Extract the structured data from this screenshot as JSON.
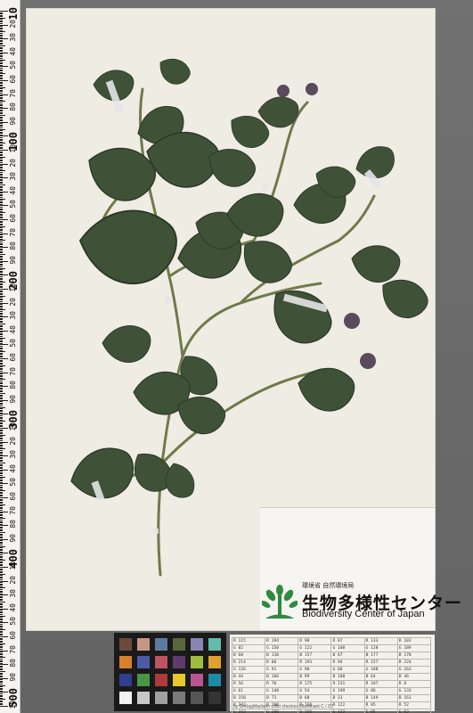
{
  "ruler": {
    "major_labels": [
      "10",
      "100",
      "200",
      "300",
      "400",
      "500"
    ],
    "minor_labels": [
      "20",
      "30",
      "40",
      "50",
      "60",
      "70",
      "80",
      "90",
      "10",
      "20",
      "30",
      "40",
      "50",
      "60",
      "70",
      "80",
      "90",
      "10",
      "20",
      "30",
      "40",
      "50",
      "60",
      "70",
      "80",
      "90",
      "10",
      "20",
      "30",
      "40",
      "50",
      "60",
      "70",
      "80",
      "90",
      "10",
      "20",
      "30",
      "40",
      "50",
      "60",
      "70",
      "80",
      "90",
      "10"
    ]
  },
  "label": {
    "org_small_jp": "環境省 自然環境局",
    "org_name_jp": "生物多様性センター",
    "org_name_en": "Biodiversity Center of Japan",
    "logo_icon": "plant-sprout-logo-icon",
    "logo_color": "#2f8a3e"
  },
  "color_checker": {
    "swatches": [
      "#6b4a3c",
      "#c59782",
      "#5f7aa0",
      "#59683c",
      "#8787b1",
      "#62bca9",
      "#d9802d",
      "#4d5ba6",
      "#bc5462",
      "#5e3b6b",
      "#9fbc3f",
      "#e0a12e",
      "#2f3e8e",
      "#4a9446",
      "#af3a3a",
      "#e9c72b",
      "#b8548f",
      "#1f89a3",
      "#f2f2f2",
      "#c8c8c8",
      "#a0a0a0",
      "#7a7a7a",
      "#555555",
      "#343434"
    ]
  },
  "reference_table": {
    "rows": [
      [
        "R 115",
        "R 194",
        "R 98",
        "R 87",
        "R 133",
        "R 103"
      ],
      [
        "G 82",
        "G 150",
        "G 122",
        "G 108",
        "G 128",
        "G 189"
      ],
      [
        "B 68",
        "B 130",
        "B 157",
        "B 67",
        "B 177",
        "B 170"
      ],
      [
        "R 214",
        "R 80",
        "R 193",
        "R 94",
        "R 157",
        "R 224"
      ],
      [
        "G 126",
        "G 91",
        "G 90",
        "G 60",
        "G 188",
        "G 163"
      ],
      [
        "B 44",
        "B 166",
        "B 99",
        "B 108",
        "B 64",
        "B 46"
      ],
      [
        "R 56",
        "R 70",
        "R 175",
        "R 231",
        "R 187",
        "R 8"
      ],
      [
        "G 61",
        "G 148",
        "G 54",
        "G 199",
        "G 86",
        "G 133"
      ],
      [
        "B 150",
        "B 73",
        "B 60",
        "B 31",
        "B 149",
        "B 161"
      ],
      [
        "R 243",
        "R 200",
        "R 160",
        "R 122",
        "R 85",
        "R 52"
      ],
      [
        "G 243",
        "G 200",
        "G 160",
        "G 122",
        "G 85",
        "G 52"
      ],
      [
        "B 242",
        "B 200",
        "B 160",
        "B 121",
        "B 85",
        "B 52"
      ]
    ],
    "caption": "by GretagMacbeth color checker (Illuminant C / 2°)"
  }
}
